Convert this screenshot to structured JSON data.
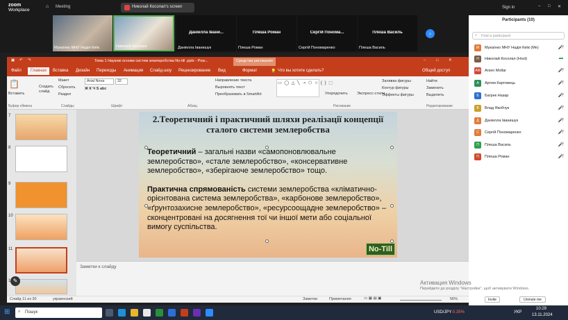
{
  "zoom": {
    "brand_line1": "zoom",
    "brand_line2": "Workplace",
    "meeting_label": "Meeting",
    "share_label": "Николай Косолап's screen",
    "sign_in": "Sign in"
  },
  "tiles": [
    {
      "name": "Мукаїнко МНУ Надія Київ",
      "kind": "video"
    },
    {
      "name": "Николай Косолап",
      "kind": "video"
    },
    {
      "big": "Даніелла Івани...",
      "name": "Даніелла Іванишук"
    },
    {
      "big": "Плеша Роман",
      "name": "Плеша Роман"
    },
    {
      "big": "Сергій Пономa...",
      "name": "Сергій Пономаренко"
    },
    {
      "big": "Плеша Василь",
      "name": "Плеша Василь"
    }
  ],
  "powerpoint": {
    "title": "Тема 1 Наукові основи систем землеробства No-till .pptx - Pow...",
    "tools_label": "Средства рисования",
    "tabs": [
      "Файл",
      "Главная",
      "Вставка",
      "Дизайн",
      "Переходы",
      "Анимация",
      "Слайд-шоу",
      "Рецензирование",
      "Вид",
      "Формат"
    ],
    "tell_me": "Что вы хотите сделать?",
    "share": "Общий доступ",
    "ribbon": {
      "paste": "Вставить",
      "new_slide": "Создать слайд",
      "layout": "Макет",
      "reset": "Сбросить",
      "section": "Раздел",
      "font_name": "Arial Nova",
      "font_size": "32",
      "text_direction": "Направление текста",
      "align_text": "Выровнять текст",
      "smartart": "Преобразовать в SmartArt",
      "arrange": "Упорядочить",
      "quick_styles": "Экспресс-стили",
      "fill": "Заливка фигуры",
      "outline": "Контур фигуры",
      "effects": "Эффекты фигуры",
      "find": "Найти",
      "replace": "Заменить",
      "select": "Выделить",
      "groups": [
        "Буфер обмена",
        "Слайды",
        "Шрифт",
        "Абзац",
        "Рисование",
        "Редактирование"
      ]
    },
    "thumb_numbers": [
      "7",
      "8",
      "9",
      "10",
      "11",
      "12"
    ],
    "notes_placeholder": "Заметки к слайду",
    "status_slide": "Слайд 11 из 30",
    "status_lang": "украинский",
    "status_notes": "Заметки",
    "status_comments": "Примечания",
    "zoom_level": "56%"
  },
  "slide": {
    "title": "2.Теоретичний і практичний шляхи реалізації концепції сталого  системи землеробства",
    "p1_bold": "Теоретичний",
    "p1_text": " – загальні назви  «самопоновлювальне землеробство», «стале землеробство», «консервативне землеробство», «зберігаюче землеробство» тощо.",
    "p2_bold": "Практична спрямованість",
    "p2_text": "  системи землеробства «кліматично-орієнтована система землеробства», «карбонове землеробство»,  «ґрунтозахисне землеробство», «ресурсоощадне землеробство» – сконцентровані   на досягнення тої чи іншої мети   або соціальної  вимогу суспільства.",
    "badge": "No-Till"
  },
  "participants": {
    "header": "Participants (10)",
    "search_placeholder": "Find a participant",
    "list": [
      {
        "initials": "М",
        "name": "Мукаїнко МНУ Надія Київ (Me)",
        "color": "#e07b39"
      },
      {
        "initials": "Н",
        "name": "Николай Косолап (Host)",
        "color": "#7a5c4a"
      },
      {
        "initials": "AM",
        "name": "Arsen Mollar",
        "color": "#d0483a"
      },
      {
        "initials": "А",
        "name": "Артем Картовець",
        "color": "#2f8f5a"
      },
      {
        "initials": "Б",
        "name": "Багрек Назар",
        "color": "#2e6fd0"
      },
      {
        "initials": "В",
        "name": "Влад Якобчук",
        "color": "#c9a227"
      },
      {
        "initials": "Д",
        "name": "Даніелла Іванишук",
        "color": "#e07b39"
      },
      {
        "initials": "С",
        "name": "Сергій Пономаренко",
        "color": "#e07b39"
      },
      {
        "initials": "П",
        "name": "Плеша Василь",
        "color": "#2f9f4f"
      },
      {
        "initials": "П",
        "name": "Плеша Роман",
        "color": "#d04a2a"
      }
    ],
    "invite": "Invite",
    "unmute": "Unmute me"
  },
  "activation": {
    "title": "Активация Windows",
    "subtitle": "Перейдите до розділу \"Настройки\", щоб активувати Windows."
  },
  "taskbar": {
    "search": "Пошук",
    "ticker": "USD/JPY",
    "ticker_change": "-0.35%",
    "lang": "УКР",
    "time": "10:29",
    "date": "13.11.2024"
  }
}
